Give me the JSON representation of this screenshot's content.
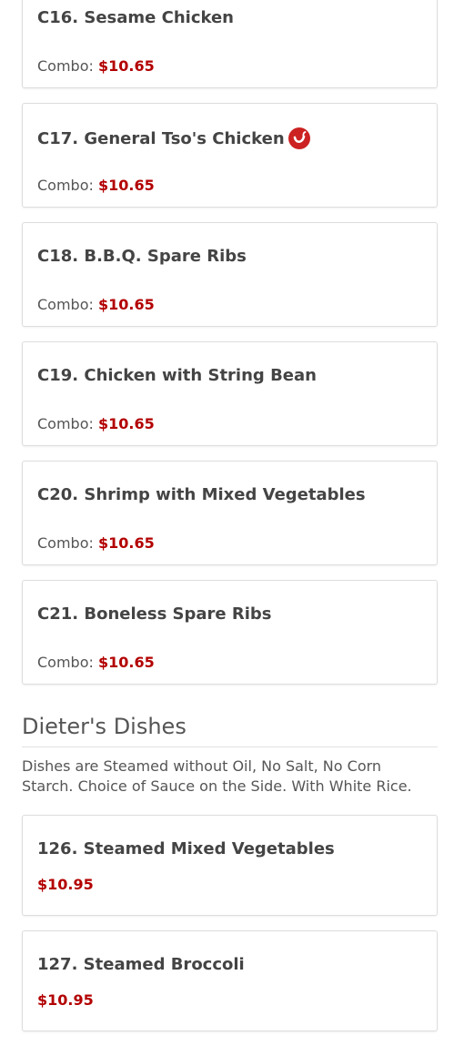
{
  "combo_items": [
    {
      "name": "C16. Sesame Chicken",
      "price_label": "Combo:",
      "price": "$10.65",
      "spicy": false
    },
    {
      "name": "C17. General Tso's Chicken",
      "price_label": "Combo:",
      "price": "$10.65",
      "spicy": true
    },
    {
      "name": "C18. B.B.Q. Spare Ribs",
      "price_label": "Combo:",
      "price": "$10.65",
      "spicy": false
    },
    {
      "name": "C19. Chicken with String Bean",
      "price_label": "Combo:",
      "price": "$10.65",
      "spicy": false
    },
    {
      "name": "C20. Shrimp with Mixed Vegetables",
      "price_label": "Combo:",
      "price": "$10.65",
      "spicy": false
    },
    {
      "name": "C21. Boneless Spare Ribs",
      "price_label": "Combo:",
      "price": "$10.65",
      "spicy": false
    }
  ],
  "dieter_section": {
    "title": "Dieter's Dishes",
    "description": "Dishes are Steamed without Oil, No Salt, No Corn Starch. Choice of Sauce on the Side. With White Rice.",
    "items": [
      {
        "name": "126. Steamed Mixed Vegetables",
        "price": "$10.95"
      },
      {
        "name": "127. Steamed Broccoli",
        "price": "$10.95"
      }
    ]
  },
  "colors": {
    "price": "#b30000",
    "spicy_icon": "#cc2222",
    "text": "#444444",
    "border": "#dddddd"
  },
  "icons": {
    "spicy": "hot-pepper-icon"
  }
}
